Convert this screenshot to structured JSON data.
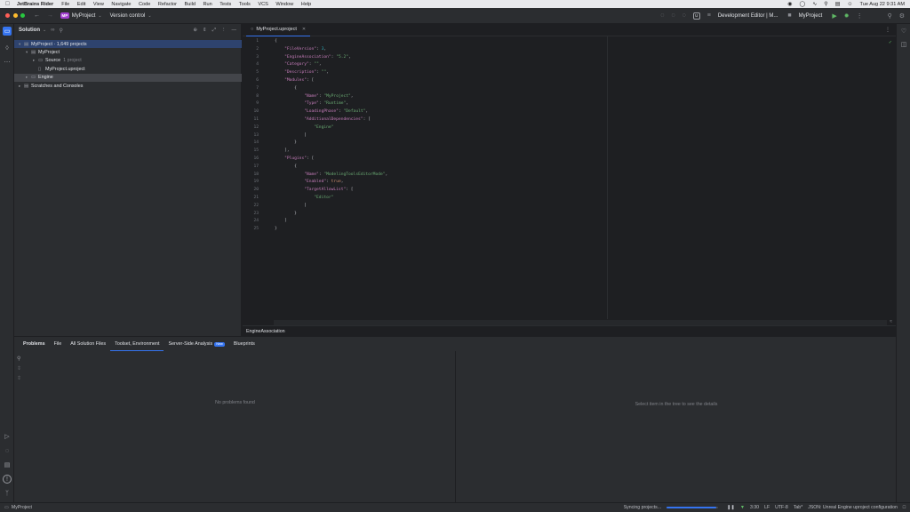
{
  "menubar": {
    "app_name": "JetBrains Rider",
    "items": [
      "File",
      "Edit",
      "View",
      "Navigate",
      "Code",
      "Refactor",
      "Build",
      "Run",
      "Tests",
      "Tools",
      "VCS",
      "Window",
      "Help"
    ],
    "datetime": "Tue Aug 22  9:31 AM"
  },
  "titlebar": {
    "project_badge": "MP",
    "project_name": "MyProject",
    "vcs_label": "Version control",
    "run_config": "Development Editor | M...",
    "run_target": "MyProject",
    "unreal_badge": "U"
  },
  "solution": {
    "title": "Solution",
    "rows": [
      {
        "label": "MyProject · 1,649 projects",
        "muted": ""
      },
      {
        "label": "MyProject",
        "muted": ""
      },
      {
        "label": "Source",
        "muted": "1 project"
      },
      {
        "label": "MyProject.uproject",
        "muted": ""
      },
      {
        "label": "Engine",
        "muted": ""
      },
      {
        "label": "Scratches and Consoles",
        "muted": ""
      }
    ]
  },
  "editor": {
    "tab_label": "MyProject.uproject",
    "breadcrumb": "EngineAssociation",
    "line_numbers": [
      "1",
      "2",
      "3",
      "4",
      "5",
      "6",
      "7",
      "8",
      "9",
      "10",
      "11",
      "12",
      "13",
      "14",
      "15",
      "16",
      "17",
      "18",
      "19",
      "20",
      "21",
      "22",
      "23",
      "24",
      "25"
    ],
    "code": {
      "l1": "{",
      "l2_key": "\"FileVersion\"",
      "l2_val": "3",
      "l3_key": "\"EngineAssociation\"",
      "l3_val": "\"5.2\"",
      "l4_key": "\"Category\"",
      "l4_val": "\"\"",
      "l5_key": "\"Description\"",
      "l5_val": "\"\"",
      "l6_key": "\"Modules\"",
      "l8_key": "\"Name\"",
      "l8_val": "\"MyProject\"",
      "l9_key": "\"Type\"",
      "l9_val": "\"Runtime\"",
      "l10_key": "\"LoadingPhase\"",
      "l10_val": "\"Default\"",
      "l11_key": "\"AdditionalDependencies\"",
      "l12_val": "\"Engine\"",
      "l16_key": "\"Plugins\"",
      "l18_key": "\"Name\"",
      "l18_val": "\"ModelingToolsEditorMode\"",
      "l19_key": "\"Enabled\"",
      "l19_val": "true",
      "l20_key": "\"TargetAllowList\"",
      "l21_val": "\"Editor\""
    }
  },
  "bottom": {
    "tabs": [
      "Problems",
      "File",
      "All Solution Files",
      "Toolset, Environment",
      "Server-Side Analysis",
      "Blueprints"
    ],
    "new_badge": "New",
    "empty_left": "No problems found",
    "empty_right": "Select item in the tree to see the details"
  },
  "statusbar": {
    "project": "MyProject",
    "sync_text": "Syncing projects...",
    "sync_progress": 0.97,
    "position": "3:30",
    "line_ending": "LF",
    "encoding": "UTF-8",
    "indent": "Tab*",
    "file_type": "JSON: Unreal Engine uproject configuration"
  },
  "colors": {
    "accent": "#3574f0",
    "panel_bg": "#2b2d30",
    "editor_bg": "#1e1f22",
    "json_key": "#c77dbb",
    "json_string": "#6aab73",
    "json_number": "#2aacb8",
    "json_keyword": "#cf8e6d"
  }
}
